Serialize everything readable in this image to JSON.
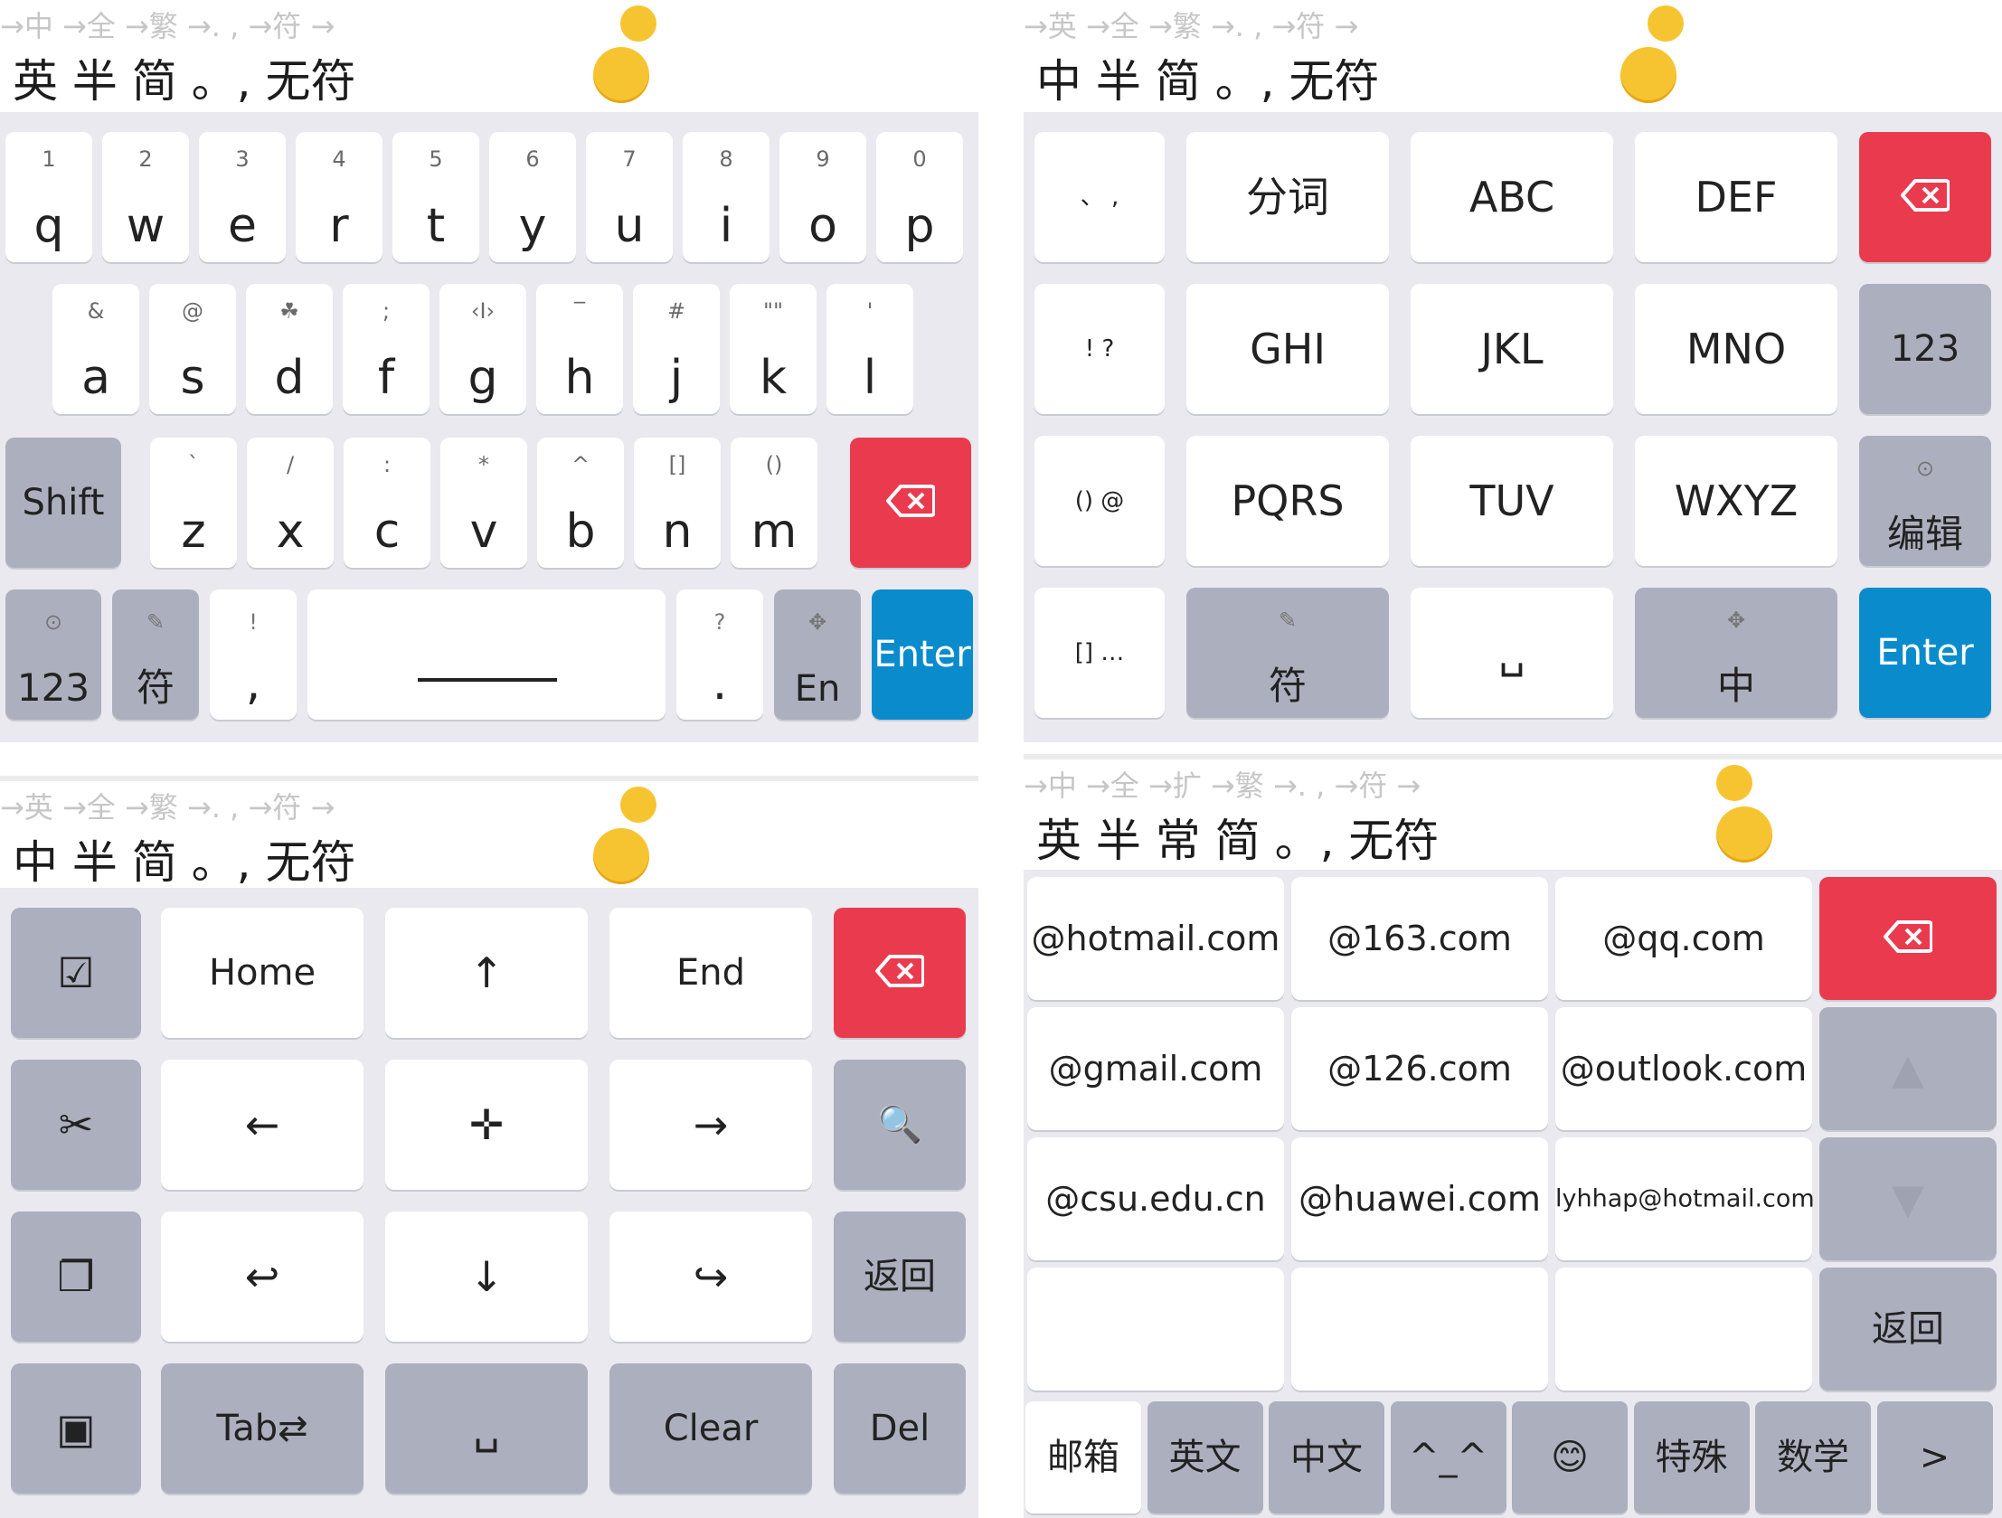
{
  "panels": {
    "en": {
      "hint": "→中   →全   →繁     →. ,       →符      →",
      "mode": "英   半   简   。,      无符",
      "row1": [
        {
          "main": "q",
          "sub": "1"
        },
        {
          "main": "w",
          "sub": "2"
        },
        {
          "main": "e",
          "sub": "3"
        },
        {
          "main": "r",
          "sub": "4"
        },
        {
          "main": "t",
          "sub": "5"
        },
        {
          "main": "y",
          "sub": "6"
        },
        {
          "main": "u",
          "sub": "7"
        },
        {
          "main": "i",
          "sub": "8"
        },
        {
          "main": "o",
          "sub": "9"
        },
        {
          "main": "p",
          "sub": "0"
        }
      ],
      "row2": [
        {
          "main": "a",
          "sub": "&"
        },
        {
          "main": "s",
          "sub": "@"
        },
        {
          "main": "d",
          "sub": "☘"
        },
        {
          "main": "f",
          "sub": ";"
        },
        {
          "main": "g",
          "sub": "‹I›"
        },
        {
          "main": "h",
          "sub": "‾"
        },
        {
          "main": "j",
          "sub": "#"
        },
        {
          "main": "k",
          "sub": "\"\""
        },
        {
          "main": "l",
          "sub": "'"
        }
      ],
      "row3": [
        {
          "main": "z",
          "sub": "`"
        },
        {
          "main": "x",
          "sub": "/"
        },
        {
          "main": "c",
          "sub": ":"
        },
        {
          "main": "v",
          "sub": "*"
        },
        {
          "main": "b",
          "sub": "^"
        },
        {
          "main": "n",
          "sub": "[]"
        },
        {
          "main": "m",
          "sub": "()"
        }
      ],
      "shift": "Shift",
      "num": "123",
      "num_sub": "⊙",
      "sym": "符",
      "sym_sub": "✎",
      "comma": ",",
      "comma_sub": "!",
      "period": ".",
      "period_sub": "?",
      "lang": "En",
      "lang_sub": "✥",
      "enter": "Enter"
    },
    "t9": {
      "hint": "→英   →全   →繁     →. ,       →符      →",
      "mode": "中   半   简   。,      无符",
      "punct1": "、 ,",
      "split": "分词",
      "abc": "ABC",
      "def": "DEF",
      "punct2": "! ?",
      "ghi": "GHI",
      "jkl": "JKL",
      "mno": "MNO",
      "num": "123",
      "punct3": "() @",
      "pqrs": "PQRS",
      "tuv": "TUV",
      "wxyz": "WXYZ",
      "edit": "编辑",
      "edit_sub": "⊙",
      "punct4": "[] …",
      "sym": "符",
      "sym_sub": "✎",
      "space": "␣",
      "lang": "中",
      "lang_sub": "✥",
      "enter": "Enter"
    },
    "edit": {
      "hint": "→英   →全   →繁     →. ,       →符      →",
      "mode": "中   半   简   。,      无符",
      "select": "☑",
      "home": "Home",
      "up": "↑",
      "end": "End",
      "cut": "✂",
      "left": "←",
      "move": "✛",
      "right": "→",
      "search": "🔍",
      "copy": "❐",
      "undo": "↩",
      "down": "↓",
      "redo": "↪",
      "back": "返回",
      "paste": "▣",
      "tab": "Tab⇄",
      "space": "␣",
      "clear": "Clear",
      "del": "Del"
    },
    "email": {
      "hint": "→中   →全   →扩   →繁     →. ,       →符      →",
      "mode": "英   半   常   简   。,      无符",
      "rows": [
        [
          "@hotmail.com",
          "@163.com",
          "@qq.com"
        ],
        [
          "@gmail.com",
          "@126.com",
          "@outlook.com"
        ],
        [
          "@csu.edu.cn",
          "@huawei.com",
          "lyhhap@hotmail.com"
        ],
        [
          "",
          "",
          ""
        ]
      ],
      "up": "▲",
      "down": "▼",
      "back": "返回",
      "tabs": [
        "邮箱",
        "英文",
        "中文",
        "^_^",
        "😊",
        "特殊",
        "数学",
        ">"
      ]
    }
  },
  "colors": {
    "delete": "#ea3a4e",
    "enter": "#0a8ccc",
    "function_key": "#acafbd",
    "keyboard_bg": "#e9e9ef"
  }
}
